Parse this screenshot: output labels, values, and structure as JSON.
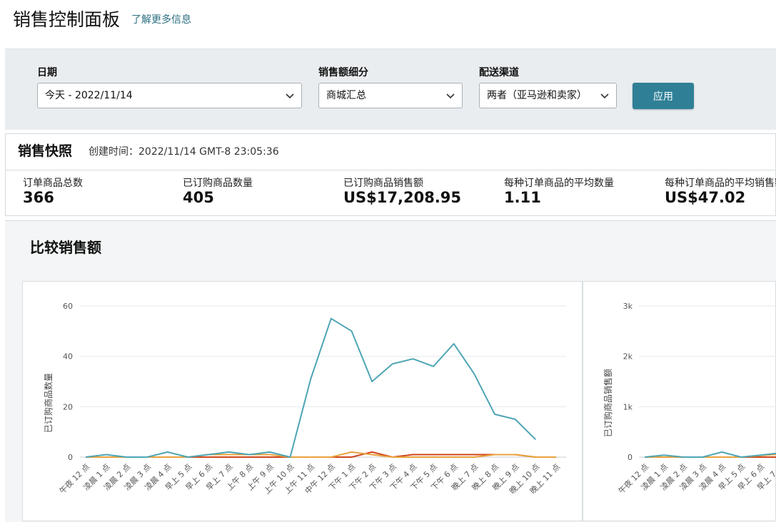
{
  "header": {
    "title": "销售控制面板",
    "learn_more": "了解更多信息"
  },
  "filters": {
    "date": {
      "label": "日期",
      "value": "今天 - 2022/11/14"
    },
    "breakdown": {
      "label": "销售额细分",
      "value": "商城汇总"
    },
    "channel": {
      "label": "配送渠道",
      "value": "两者（亚马逊和卖家）"
    },
    "apply_label": "应用"
  },
  "snapshot": {
    "title": "销售快照",
    "created": "创建时间：2022/11/14 GMT-8 23:05:36",
    "metrics": [
      {
        "label": "订单商品总数",
        "value": "366"
      },
      {
        "label": "已订购商品数量",
        "value": "405"
      },
      {
        "label": "已订购商品销售额",
        "value": "US$17,208.95"
      },
      {
        "label": "每种订单商品的平均数量",
        "value": "1.11"
      },
      {
        "label": "每种订单商品的平均销售额",
        "value": "US$47.02"
      }
    ]
  },
  "compare": {
    "title": "比较销售额"
  },
  "colors": {
    "accent": "#2f8096",
    "teal": "#4ea5b4",
    "orange": "#e8a23c",
    "red": "#d0451b"
  },
  "chart_data": [
    {
      "type": "line",
      "ylabel": "已订购商品数量",
      "ylim": [
        0,
        60
      ],
      "yticks": [
        "0",
        "20",
        "40",
        "60"
      ],
      "categories": [
        "午夜 12 点",
        "凌晨 1 点",
        "凌晨 2 点",
        "凌晨 3 点",
        "凌晨 4 点",
        "早上 5 点",
        "早上 6 点",
        "早上 7 点",
        "上午 8 点",
        "上午 9 点",
        "上午 10 点",
        "上午 11 点",
        "中午 12 点",
        "下午 1 点",
        "下午 2 点",
        "下午 3 点",
        "下午 4 点",
        "下午 5 点",
        "下午 6 点",
        "晚上 7 点",
        "晚上 8 点",
        "晚上 9 点",
        "晚上 10 点",
        "晚上 11 点"
      ],
      "series": [
        {
          "color": "#4ea5b4",
          "values": [
            0,
            1,
            0,
            0,
            2,
            0,
            1,
            2,
            1,
            2,
            0,
            31,
            55,
            50,
            30,
            37,
            39,
            36,
            45,
            33,
            17,
            15,
            7,
            null
          ]
        },
        {
          "color": "#e8a23c",
          "values": [
            0,
            0,
            0,
            0,
            0,
            0,
            1,
            1,
            1,
            1,
            0,
            0,
            0,
            2,
            1,
            0,
            0,
            0,
            0,
            0,
            1,
            1,
            0,
            0
          ]
        },
        {
          "color": "#d0451b",
          "values": [
            0,
            0,
            0,
            0,
            0,
            0,
            0,
            0,
            0,
            0,
            0,
            0,
            0,
            0,
            2,
            0,
            1,
            1,
            1,
            1,
            1,
            1,
            0,
            0
          ]
        }
      ],
      "grid": true
    },
    {
      "type": "line",
      "ylabel": "已订购商品销售额",
      "ylim": [
        0,
        3000
      ],
      "yticks": [
        "0",
        "1k",
        "2k",
        "3k"
      ],
      "categories": [
        "午夜 12 点",
        "凌晨 1 点",
        "凌晨 2 点",
        "凌晨 3 点",
        "凌晨 4 点",
        "早上 5 点",
        "早上 6 点",
        "早上 7 点"
      ],
      "series": [
        {
          "color": "#4ea5b4",
          "values": [
            0,
            40,
            0,
            0,
            100,
            0,
            40,
            80
          ]
        },
        {
          "color": "#e8a23c",
          "values": [
            0,
            0,
            0,
            0,
            0,
            0,
            30,
            60
          ]
        },
        {
          "color": "#d0451b",
          "values": [
            0,
            0,
            0,
            0,
            0,
            0,
            0,
            0
          ]
        }
      ],
      "grid": true
    }
  ]
}
